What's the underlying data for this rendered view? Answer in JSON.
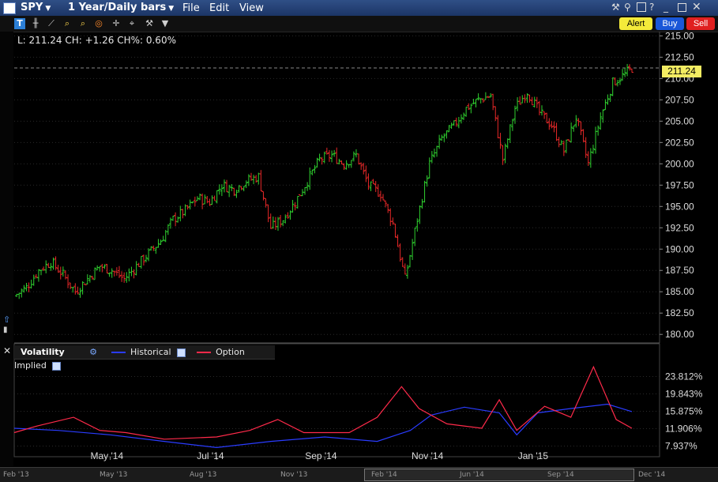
{
  "window": {
    "symbol": "SPY",
    "period": "1 Year/Daily bars",
    "menus": [
      "File",
      "Edit",
      "View"
    ]
  },
  "buttons": {
    "alert": "Alert",
    "buy": "Buy",
    "sell": "Sell"
  },
  "price_readout": "L: 211.24 CH: +1.26 CH%: 0.60%",
  "last_price": "211.24",
  "volatility_panel": {
    "title": "Volatility",
    "legend": [
      {
        "name": "Historical",
        "color": "#2a3cff"
      },
      {
        "name": "Option Implied",
        "color": "#ff2a4a"
      }
    ]
  },
  "colors": {
    "up": "#2fd02f",
    "down": "#e82828",
    "background": "#000000",
    "grid": "#2a2a2a"
  },
  "toolbar_icons": [
    "text-tool-icon",
    "bar-style-icon",
    "draw-line-icon",
    "zoom-in-icon",
    "zoom-out-icon",
    "target-icon",
    "crosshair-icon",
    "annotation-icon",
    "settings-wrench-icon",
    "dropdown-arrow-icon"
  ],
  "scrollbar_labels": [
    "Feb '13",
    "May '13",
    "Aug '13",
    "Nov '13",
    "Feb '14",
    "Jun '14",
    "Sep '14",
    "Dec '14"
  ],
  "chart_data": [
    {
      "type": "bar",
      "subtype": "ohlc",
      "x_tick_labels": [
        "May '14",
        "Jul '14",
        "Sep '14",
        "Nov '14",
        "Jan '15"
      ],
      "y_tick_labels": [
        "215.00",
        "212.50",
        "210.00",
        "207.50",
        "205.00",
        "202.50",
        "200.00",
        "197.50",
        "195.00",
        "192.50",
        "190.00",
        "187.50",
        "185.00",
        "182.50",
        "180.00"
      ],
      "ylim": [
        179.0,
        215.5
      ],
      "close_series": [
        {
          "date": "2014-03-07",
          "close": 184.5
        },
        {
          "date": "2014-03-14",
          "close": 185.5
        },
        {
          "date": "2014-03-21",
          "close": 187.5
        },
        {
          "date": "2014-03-28",
          "close": 188.5
        },
        {
          "date": "2014-04-04",
          "close": 187.0
        },
        {
          "date": "2014-04-11",
          "close": 185.0
        },
        {
          "date": "2014-04-18",
          "close": 186.5
        },
        {
          "date": "2014-04-25",
          "close": 188.0
        },
        {
          "date": "2014-05-02",
          "close": 187.5
        },
        {
          "date": "2014-05-09",
          "close": 186.5
        },
        {
          "date": "2014-05-16",
          "close": 188.0
        },
        {
          "date": "2014-05-23",
          "close": 189.5
        },
        {
          "date": "2014-05-30",
          "close": 191.0
        },
        {
          "date": "2014-06-06",
          "close": 193.5
        },
        {
          "date": "2014-06-13",
          "close": 194.5
        },
        {
          "date": "2014-06-20",
          "close": 196.0
        },
        {
          "date": "2014-06-27",
          "close": 195.5
        },
        {
          "date": "2014-07-04",
          "close": 197.5
        },
        {
          "date": "2014-07-11",
          "close": 197.0
        },
        {
          "date": "2014-07-18",
          "close": 198.0
        },
        {
          "date": "2014-07-25",
          "close": 198.5
        },
        {
          "date": "2014-08-01",
          "close": 192.5
        },
        {
          "date": "2014-08-08",
          "close": 193.5
        },
        {
          "date": "2014-08-15",
          "close": 195.5
        },
        {
          "date": "2014-08-22",
          "close": 198.0
        },
        {
          "date": "2014-08-29",
          "close": 200.5
        },
        {
          "date": "2014-09-05",
          "close": 201.0
        },
        {
          "date": "2014-09-12",
          "close": 200.0
        },
        {
          "date": "2014-09-19",
          "close": 201.0
        },
        {
          "date": "2014-09-26",
          "close": 197.5
        },
        {
          "date": "2014-10-03",
          "close": 196.5
        },
        {
          "date": "2014-10-10",
          "close": 193.0
        },
        {
          "date": "2014-10-17",
          "close": 186.5
        },
        {
          "date": "2014-10-24",
          "close": 193.5
        },
        {
          "date": "2014-10-31",
          "close": 200.0
        },
        {
          "date": "2014-11-07",
          "close": 203.0
        },
        {
          "date": "2014-11-14",
          "close": 204.5
        },
        {
          "date": "2014-11-21",
          "close": 206.5
        },
        {
          "date": "2014-11-28",
          "close": 207.5
        },
        {
          "date": "2014-12-05",
          "close": 208.0
        },
        {
          "date": "2014-12-12",
          "close": 200.5
        },
        {
          "date": "2014-12-19",
          "close": 206.5
        },
        {
          "date": "2014-12-26",
          "close": 208.5
        },
        {
          "date": "2015-01-02",
          "close": 206.0
        },
        {
          "date": "2015-01-09",
          "close": 204.5
        },
        {
          "date": "2015-01-16",
          "close": 201.5
        },
        {
          "date": "2015-01-23",
          "close": 205.5
        },
        {
          "date": "2015-01-30",
          "close": 200.0
        },
        {
          "date": "2015-02-06",
          "close": 205.5
        },
        {
          "date": "2015-02-13",
          "close": 209.5
        },
        {
          "date": "2015-02-20",
          "close": 210.5
        },
        {
          "date": "2015-02-24",
          "close": 211.24
        }
      ]
    },
    {
      "type": "line",
      "title": "Volatility",
      "y_tick_labels": [
        "23.812%",
        "19.843%",
        "15.875%",
        "11.906%",
        "7.937%"
      ],
      "ylim": [
        5.5,
        27.5
      ],
      "series": [
        {
          "name": "Historical",
          "points": [
            {
              "date": "2014-03-07",
              "v": 12.0
            },
            {
              "date": "2014-04-01",
              "v": 11.5
            },
            {
              "date": "2014-05-01",
              "v": 10.5
            },
            {
              "date": "2014-06-01",
              "v": 9.0
            },
            {
              "date": "2014-07-01",
              "v": 7.6
            },
            {
              "date": "2014-08-01",
              "v": 9.0
            },
            {
              "date": "2014-09-01",
              "v": 10.0
            },
            {
              "date": "2014-10-01",
              "v": 9.0
            },
            {
              "date": "2014-10-20",
              "v": 11.5
            },
            {
              "date": "2014-11-01",
              "v": 15.0
            },
            {
              "date": "2014-11-20",
              "v": 16.8
            },
            {
              "date": "2014-12-10",
              "v": 15.5
            },
            {
              "date": "2014-12-20",
              "v": 10.5
            },
            {
              "date": "2015-01-01",
              "v": 15.5
            },
            {
              "date": "2015-01-20",
              "v": 16.5
            },
            {
              "date": "2015-02-10",
              "v": 17.5
            },
            {
              "date": "2015-02-24",
              "v": 15.8
            }
          ]
        },
        {
          "name": "Option Implied",
          "points": [
            {
              "date": "2014-03-07",
              "v": 11.0
            },
            {
              "date": "2014-03-20",
              "v": 12.5
            },
            {
              "date": "2014-04-10",
              "v": 14.5
            },
            {
              "date": "2014-04-25",
              "v": 11.5
            },
            {
              "date": "2014-05-10",
              "v": 11.0
            },
            {
              "date": "2014-06-01",
              "v": 9.5
            },
            {
              "date": "2014-07-01",
              "v": 10.0
            },
            {
              "date": "2014-07-20",
              "v": 11.5
            },
            {
              "date": "2014-08-05",
              "v": 14.0
            },
            {
              "date": "2014-08-20",
              "v": 11.0
            },
            {
              "date": "2014-09-15",
              "v": 11.0
            },
            {
              "date": "2014-10-01",
              "v": 14.5
            },
            {
              "date": "2014-10-15",
              "v": 21.5
            },
            {
              "date": "2014-10-25",
              "v": 16.5
            },
            {
              "date": "2014-11-10",
              "v": 13.0
            },
            {
              "date": "2014-11-30",
              "v": 12.0
            },
            {
              "date": "2014-12-10",
              "v": 18.5
            },
            {
              "date": "2014-12-20",
              "v": 11.5
            },
            {
              "date": "2015-01-05",
              "v": 17.0
            },
            {
              "date": "2015-01-20",
              "v": 14.5
            },
            {
              "date": "2015-02-02",
              "v": 26.0
            },
            {
              "date": "2015-02-15",
              "v": 14.0
            },
            {
              "date": "2015-02-24",
              "v": 12.0
            }
          ]
        }
      ]
    }
  ]
}
